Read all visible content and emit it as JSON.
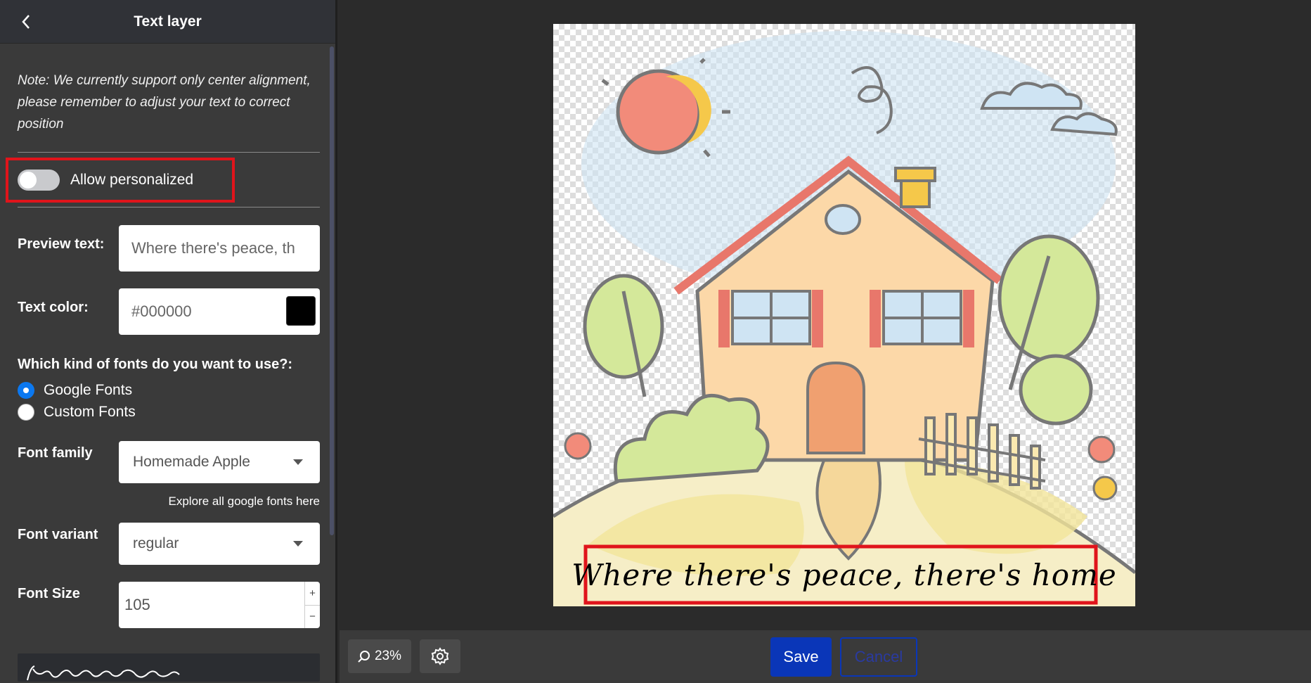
{
  "header": {
    "title": "Text layer",
    "back_icon": "chevron-left-icon"
  },
  "note": "Note: We currently support only center alignment, please remember to adjust your text to correct position",
  "personalize": {
    "label": "Allow personalized",
    "enabled": false
  },
  "preview_text": {
    "label": "Preview text:",
    "value": "Where there's peace, th"
  },
  "text_color": {
    "label": "Text color:",
    "value": "#000000",
    "swatch": "#000000"
  },
  "fonts": {
    "question": "Which kind of fonts do you want to use?:",
    "options": [
      "Google Fonts",
      "Custom Fonts"
    ],
    "selected": "Google Fonts"
  },
  "font_family": {
    "label": "Font family",
    "value": "Homemade Apple",
    "explore_link": "Explore all google fonts here"
  },
  "font_variant": {
    "label": "Font variant",
    "value": "regular"
  },
  "font_size": {
    "label": "Font Size",
    "value": "105"
  },
  "canvas": {
    "text": "Where there's peace, there's home",
    "highlight_color": "#e0141b"
  },
  "toolbar": {
    "zoom_label": "23%",
    "zoom_icon": "zoom-icon",
    "settings_icon": "gear-icon",
    "save_label": "Save",
    "cancel_label": "Cancel",
    "save_color": "#0a36b8"
  }
}
